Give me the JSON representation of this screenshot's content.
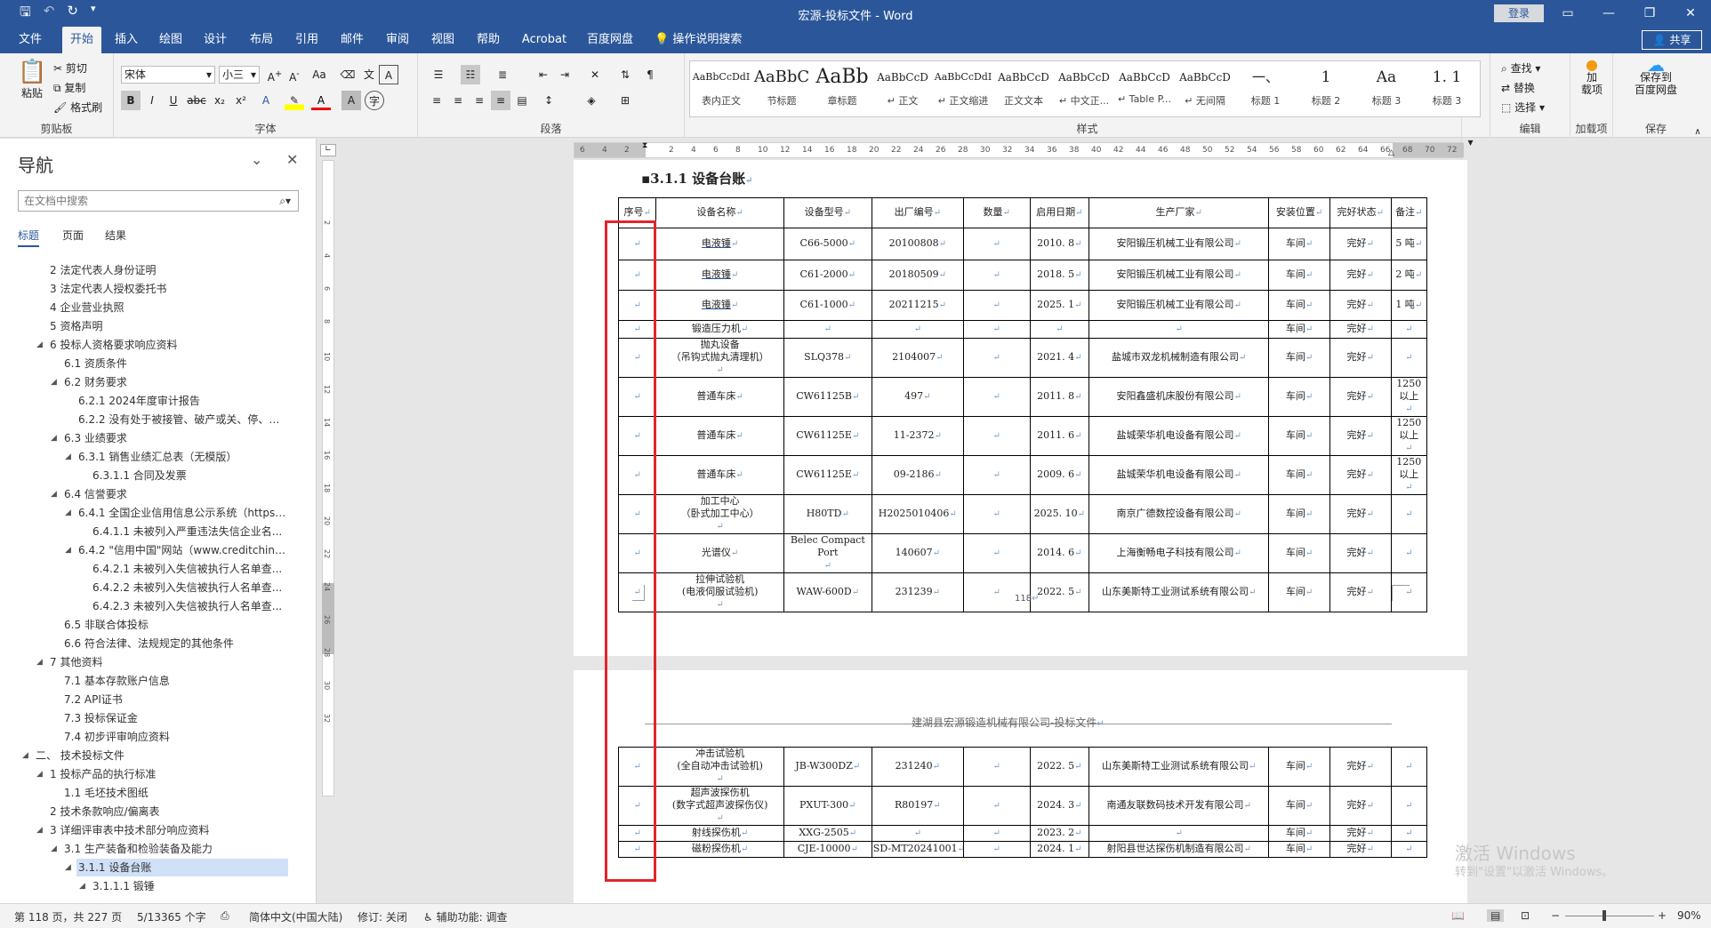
{
  "window": {
    "title": "宏源-投标文件 - Word",
    "login": "登录",
    "share": "共享"
  },
  "tabs": [
    "文件",
    "开始",
    "插入",
    "绘图",
    "设计",
    "布局",
    "引用",
    "邮件",
    "审阅",
    "视图",
    "帮助",
    "Acrobat",
    "百度网盘"
  ],
  "tell_me": "操作说明搜索",
  "ribbon": {
    "clipboard": {
      "paste": "粘贴",
      "cut": "剪切",
      "copy": "复制",
      "format_painter": "格式刷",
      "label": "剪贴板"
    },
    "font": {
      "name": "宋体",
      "size": "小三",
      "label": "字体"
    },
    "paragraph": {
      "label": "段落"
    },
    "styles": {
      "label": "样式",
      "items": [
        {
          "preview": "AaBbCcDdI",
          "name": "表内正文"
        },
        {
          "preview": "AaBbC",
          "name": "节标题"
        },
        {
          "preview": "AaBb",
          "name": "章标题"
        },
        {
          "preview": "AaBbCcD",
          "name": "↵ 正文"
        },
        {
          "preview": "AaBbCcDdI",
          "name": "↵ 正文缩进"
        },
        {
          "preview": "AaBbCcD",
          "name": "正文文本"
        },
        {
          "preview": "AaBbCcD",
          "name": "↵ 中文正..."
        },
        {
          "preview": "AaBbCcD",
          "name": "↵ Table P..."
        },
        {
          "preview": "AaBbCcD",
          "name": "↵ 无间隔"
        },
        {
          "preview": "一、",
          "name": "标题 1"
        },
        {
          "preview": "1",
          "name": "标题 2"
        },
        {
          "preview": "Aa",
          "name": "标题 3"
        },
        {
          "preview": "1. 1",
          "name": "标题 3"
        }
      ]
    },
    "editing": {
      "find": "查找",
      "replace": "替换",
      "select": "选择",
      "label": "编辑"
    },
    "addin": {
      "btn": "加\n载项",
      "label": "加载项"
    },
    "save": {
      "btn": "保存到\n百度网盘",
      "label": "保存"
    }
  },
  "nav": {
    "title": "导航",
    "search_placeholder": "在文档中搜索",
    "tabs": [
      "标题",
      "页面",
      "结果"
    ],
    "items": [
      {
        "text": "2 法定代表人身份证明",
        "level": 1,
        "tri": ""
      },
      {
        "text": "3 法定代表人授权委托书",
        "level": 1,
        "tri": ""
      },
      {
        "text": "4 企业营业执照",
        "level": 1,
        "tri": ""
      },
      {
        "text": "5 资格声明",
        "level": 1,
        "tri": ""
      },
      {
        "text": "6 投标人资格要求响应资料",
        "level": 1,
        "tri": "◢"
      },
      {
        "text": "6.1 资质条件",
        "level": 2,
        "tri": ""
      },
      {
        "text": "6.2 财务要求",
        "level": 2,
        "tri": "◢"
      },
      {
        "text": "6.2.1 2024年度审计报告",
        "level": 3,
        "tri": ""
      },
      {
        "text": "6.2.2 没有处于被接管、破产或关、停、并...",
        "level": 3,
        "tri": ""
      },
      {
        "text": "6.3 业绩要求",
        "level": 2,
        "tri": "◢"
      },
      {
        "text": "6.3.1 销售业绩汇总表（无模版）",
        "level": 3,
        "tri": "◢"
      },
      {
        "text": "6.3.1.1 合同及发票",
        "level": 4,
        "tri": ""
      },
      {
        "text": "6.4 信誉要求",
        "level": 2,
        "tri": "◢"
      },
      {
        "text": "6.4.1 全国企业信用信息公示系统（https:...",
        "level": 3,
        "tri": "◢"
      },
      {
        "text": "6.4.1.1 未被列入严重违法失信企业名...",
        "level": 4,
        "tri": ""
      },
      {
        "text": "6.4.2 \"信用中国\"网站（www.creditchina....",
        "level": 3,
        "tri": "◢"
      },
      {
        "text": "6.4.2.1 未被列入失信被执行人名单查...",
        "level": 4,
        "tri": ""
      },
      {
        "text": "6.4.2.2 未被列入失信被执行人名单查...",
        "level": 4,
        "tri": ""
      },
      {
        "text": "6.4.2.3 未被列入失信被执行人名单查...",
        "level": 4,
        "tri": ""
      },
      {
        "text": "6.5 非联合体投标",
        "level": 2,
        "tri": ""
      },
      {
        "text": "6.6 符合法律、法规规定的其他条件",
        "level": 2,
        "tri": ""
      },
      {
        "text": "7 其他资料",
        "level": 1,
        "tri": "◢"
      },
      {
        "text": "7.1 基本存款账户信息",
        "level": 2,
        "tri": ""
      },
      {
        "text": "7.2 API证书",
        "level": 2,
        "tri": ""
      },
      {
        "text": "7.3 投标保证金",
        "level": 2,
        "tri": ""
      },
      {
        "text": "7.4 初步评审响应资料",
        "level": 2,
        "tri": ""
      },
      {
        "text": "二、 技术投标文件",
        "level": 0,
        "tri": "◢"
      },
      {
        "text": "1 投标产品的执行标准",
        "level": 1,
        "tri": "◢"
      },
      {
        "text": "1.1 毛坯技术图纸",
        "level": 2,
        "tri": ""
      },
      {
        "text": "2 技术条款响应/偏离表",
        "level": 1,
        "tri": ""
      },
      {
        "text": "3 详细评审表中技术部分响应资料",
        "level": 1,
        "tri": "◢"
      },
      {
        "text": "3.1 生产装备和检验装备及能力",
        "level": 2,
        "tri": "◢"
      },
      {
        "text": "3.1.1 设备台账",
        "level": 3,
        "tri": "◢",
        "sel": true
      },
      {
        "text": "3.1.1.1 锻锤",
        "level": 4,
        "tri": "◢"
      }
    ]
  },
  "ruler": {
    "h": [
      "6",
      "4",
      "2",
      "",
      "2",
      "4",
      "6",
      "8",
      "10",
      "12",
      "14",
      "16",
      "18",
      "20",
      "22",
      "24",
      "26",
      "28",
      "30",
      "32",
      "34",
      "36",
      "38",
      "40",
      "42",
      "44",
      "46",
      "48",
      "50",
      "52",
      "54",
      "56",
      "58",
      "60",
      "62",
      "64",
      "66",
      "68",
      "70",
      "72"
    ],
    "v": [
      "2",
      "4",
      "6",
      "8",
      "10",
      "12",
      "14",
      "16",
      "18",
      "20",
      "22",
      "24",
      "26",
      "28",
      "30",
      "32"
    ]
  },
  "doc": {
    "heading": "3.1.1 设备台账",
    "page_number": "118",
    "header2": "建湖县宏源锻造机械有限公司-投标文件",
    "table_headers": [
      "序号",
      "设备名称",
      "设备型号",
      "出厂编号",
      "数量",
      "启用日期",
      "生产厂家",
      "安装位置",
      "完好状态",
      "备注"
    ],
    "rows_page1": [
      [
        "",
        "电液锤",
        "C66-5000",
        "20100808",
        "",
        "2010. 8",
        "安阳锻压机械工业有限公司",
        "车间",
        "完好",
        "5 吨"
      ],
      [
        "",
        "电液锤",
        "C61-2000",
        "20180509",
        "",
        "2018. 5",
        "安阳锻压机械工业有限公司",
        "车间",
        "完好",
        "2 吨"
      ],
      [
        "",
        "电液锤",
        "C61-1000",
        "20211215",
        "",
        "2025. 1",
        "安阳锻压机械工业有限公司",
        "车间",
        "完好",
        "1 吨"
      ],
      [
        "",
        "锻造压力机",
        "",
        "",
        "",
        "",
        "",
        "车间",
        "完好",
        ""
      ],
      [
        "",
        "抛丸设备\n（吊钩式抛丸清理机）",
        "SLQ378",
        "2104007",
        "",
        "2021. 4",
        "盐城市双龙机械制造有限公司",
        "车间",
        "完好",
        ""
      ],
      [
        "",
        "普通车床",
        "CW61125B",
        "497",
        "",
        "2011. 8",
        "安阳鑫盛机床股份有限公司",
        "车间",
        "完好",
        "1250\n以上"
      ],
      [
        "",
        "普通车床",
        "CW61125E",
        "11-2372",
        "",
        "2011. 6",
        "盐城荣华机电设备有限公司",
        "车间",
        "完好",
        "1250\n以上"
      ],
      [
        "",
        "普通车床",
        "CW61125E",
        "09-2186",
        "",
        "2009. 6",
        "盐城荣华机电设备有限公司",
        "车间",
        "完好",
        "1250\n以上"
      ],
      [
        "",
        "加工中心\n（卧式加工中心）",
        "H80TD",
        "H2025010406",
        "",
        "2025. 10",
        "南京广德数控设备有限公司",
        "车间",
        "完好",
        ""
      ],
      [
        "",
        "光谱仪",
        "Belec Compact\nPort",
        "140607",
        "",
        "2014. 6",
        "上海衡畅电子科技有限公司",
        "车间",
        "完好",
        ""
      ],
      [
        "",
        "拉伸试验机\n(电液伺服试验机)",
        "WAW-600D",
        "231239",
        "",
        "2022. 5",
        "山东美斯特工业测试系统有限公司",
        "车间",
        "完好",
        ""
      ]
    ],
    "rows_page2": [
      [
        "",
        "冲击试验机\n(全自动冲击试验机)",
        "JB-W300DZ",
        "231240",
        "",
        "2022. 5",
        "山东美斯特工业测试系统有限公司",
        "车间",
        "完好",
        ""
      ],
      [
        "",
        "超声波探伤机\n(数字式超声波探伤仪)",
        "PXUT-300",
        "R80197",
        "",
        "2024. 3",
        "南通友联数码技术开发有限公司",
        "车间",
        "完好",
        ""
      ],
      [
        "",
        "射线探伤机",
        "XXG-2505",
        "",
        "",
        "2023. 2",
        "",
        "车间",
        "完好",
        ""
      ],
      [
        "",
        "磁粉探伤机",
        "CJE-10000",
        "SD-MT20241001",
        "",
        "2024. 1",
        "射阳县世达探伤机制造有限公司",
        "车间",
        "完好",
        ""
      ]
    ]
  },
  "watermark": {
    "line1": "激活 Windows",
    "line2": "转到\"设置\"以激活 Windows。"
  },
  "status": {
    "page": "第 118 页，共 227 页",
    "words": "5/13365 个字",
    "lang": "简体中文(中国大陆)",
    "track": "修订: 关闭",
    "access": "辅助功能: 调查",
    "zoom": "90%"
  }
}
